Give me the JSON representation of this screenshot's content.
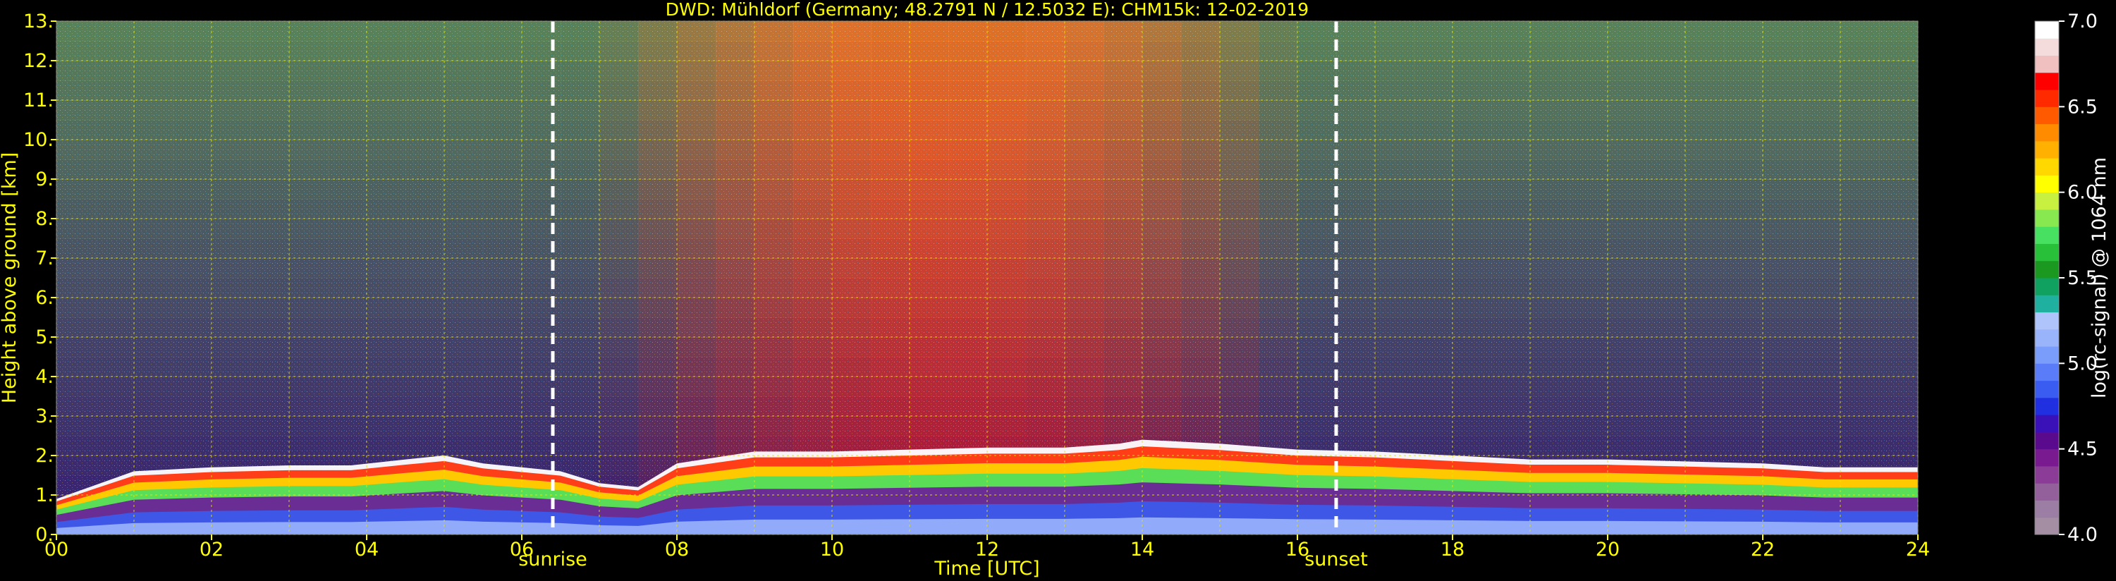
{
  "chart_data": {
    "type": "heatmap",
    "title": "DWD: Mühldorf (Germany; 48.2791 N / 12.5032 E):    CHM15k: 12-02-2019",
    "xlabel": "Time [UTC]",
    "ylabel": "Height above ground [km]",
    "xlim": [
      0,
      24
    ],
    "ylim": [
      0,
      13
    ],
    "x_ticks": [
      "00",
      "02",
      "04",
      "06",
      "08",
      "10",
      "12",
      "14",
      "16",
      "18",
      "20",
      "22",
      "24"
    ],
    "y_ticks": [
      "0.",
      "1.",
      "2.",
      "3.",
      "4.",
      "5.",
      "6.",
      "7.",
      "8.",
      "9.",
      "10.",
      "11.",
      "12.",
      "13."
    ],
    "grid": true,
    "events": [
      {
        "label": "sunrise",
        "time": 6.4
      },
      {
        "label": "sunset",
        "time": 16.5
      }
    ],
    "colorbar": {
      "label": "log(rc-signal) @ 1064 nm",
      "range": [
        4.0,
        7.0
      ],
      "ticks": [
        "4.0",
        "4.5",
        "5.0",
        "5.5",
        "6.0",
        "6.5",
        "7.0"
      ],
      "colors": [
        "#a48ea4",
        "#9c7ea4",
        "#94609c",
        "#8a3c96",
        "#7a1a90",
        "#5a0a8c",
        "#3a10b8",
        "#2030e0",
        "#3a5cf0",
        "#5a7cf8",
        "#7a9cfa",
        "#9ab4fc",
        "#b0c4fc",
        "#20b0a0",
        "#10a060",
        "#1a9820",
        "#28c038",
        "#48e060",
        "#88e850",
        "#c8f040",
        "#ffff00",
        "#ffd800",
        "#ffb000",
        "#ff8c00",
        "#ff5a00",
        "#ff2a00",
        "#ff0000",
        "#f0c0c0",
        "#f4dcdc",
        "#ffffff"
      ]
    },
    "boundary_layer_top_km": {
      "time": [
        0,
        1,
        2,
        3,
        3.8,
        4.5,
        5,
        5.5,
        6,
        6.5,
        7,
        7.5,
        8,
        9,
        10,
        11,
        12,
        13,
        13.7,
        14,
        15,
        16,
        17,
        18,
        19,
        20,
        21,
        22,
        22.8,
        23.3,
        24
      ],
      "height": [
        0.9,
        1.6,
        1.7,
        1.75,
        1.75,
        1.9,
        2.0,
        1.8,
        1.7,
        1.6,
        1.3,
        1.2,
        1.8,
        2.1,
        2.1,
        2.15,
        2.2,
        2.2,
        2.3,
        2.4,
        2.3,
        2.15,
        2.1,
        2.0,
        1.9,
        1.9,
        1.85,
        1.8,
        1.7,
        1.7,
        1.7
      ]
    }
  }
}
